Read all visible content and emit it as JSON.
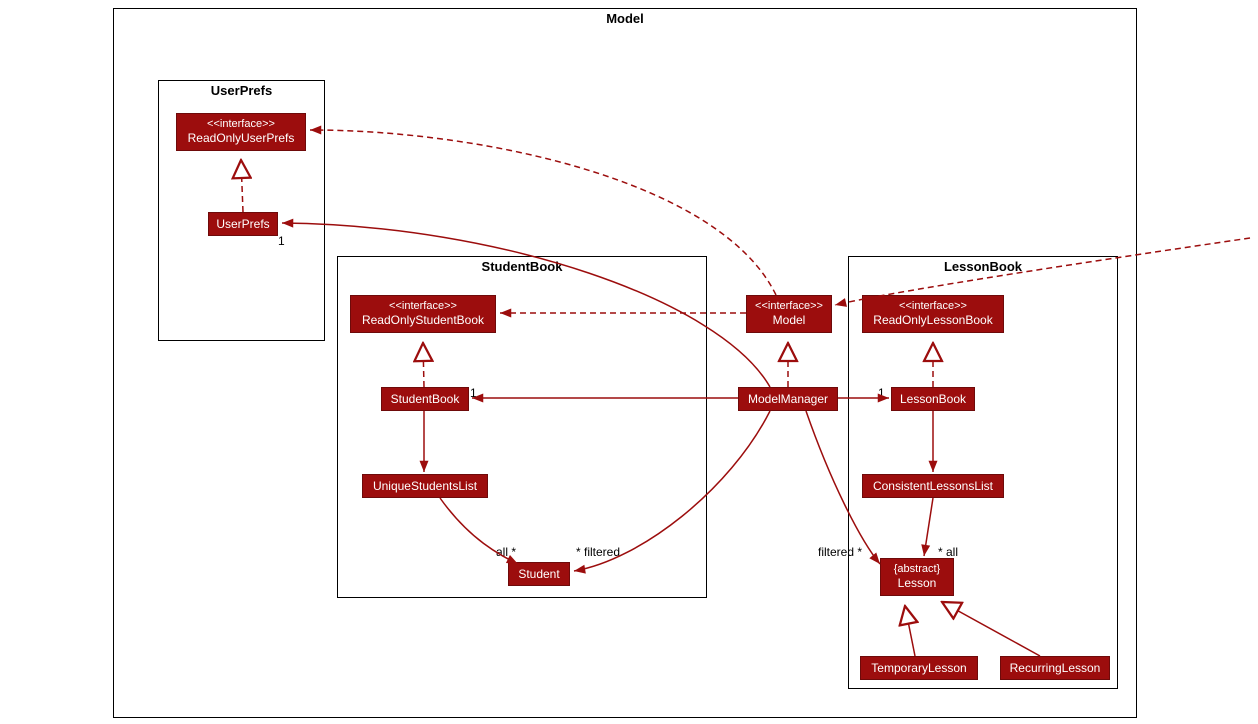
{
  "packages": {
    "model": "Model",
    "userPrefs": "UserPrefs",
    "studentBook": "StudentBook",
    "lessonBook": "LessonBook"
  },
  "nodes": {
    "readOnlyUserPrefs": {
      "stereo": "<<interface>>",
      "name": "ReadOnlyUserPrefs"
    },
    "userPrefs": {
      "name": "UserPrefs"
    },
    "readOnlyStudentBook": {
      "stereo": "<<interface>>",
      "name": "ReadOnlyStudentBook"
    },
    "studentBook": {
      "name": "StudentBook"
    },
    "uniqueStudentsList": {
      "name": "UniqueStudentsList"
    },
    "student": {
      "name": "Student"
    },
    "modelIface": {
      "stereo": "<<interface>>",
      "name": "Model"
    },
    "modelManager": {
      "name": "ModelManager"
    },
    "readOnlyLessonBook": {
      "stereo": "<<interface>>",
      "name": "ReadOnlyLessonBook"
    },
    "lessonBook": {
      "name": "LessonBook"
    },
    "consistentLessonsList": {
      "name": "ConsistentLessonsList"
    },
    "lesson": {
      "stereo": "{abstract}",
      "name": "Lesson"
    },
    "temporaryLesson": {
      "name": "TemporaryLesson"
    },
    "recurringLesson": {
      "name": "RecurringLesson"
    }
  },
  "labels": {
    "mmToUserPrefs": "1",
    "mmToStudentBook": "1",
    "mmToLessonBook": "1",
    "allStar": "all *",
    "filteredStar": "* filtered",
    "filteredStar2": "filtered *",
    "allStar2": "* all"
  }
}
